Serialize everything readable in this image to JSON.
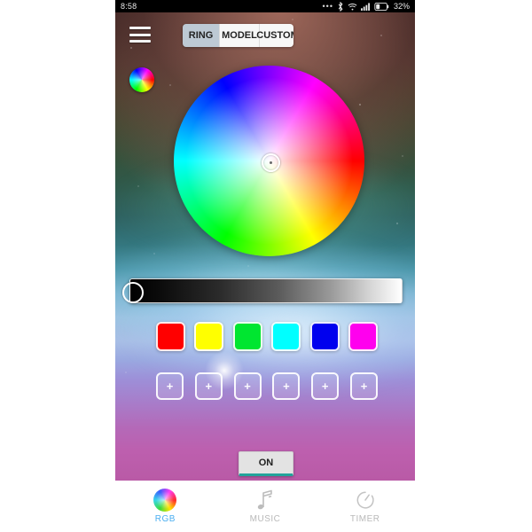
{
  "statusbar": {
    "time": "8:58",
    "more_dots": "•••",
    "bluetooth_icon": "bluetooth-icon",
    "wifi_icon": "wifi-icon",
    "signal_icon": "signal-icon",
    "battery_icon": "battery-icon",
    "battery_pct": "32%"
  },
  "topbar": {
    "menu_icon": "hamburger-menu-icon",
    "wheel_icon": "color-wheel-icon",
    "tabs": [
      {
        "label": "RING",
        "selected": true
      },
      {
        "label": "MODEL",
        "selected": false
      },
      {
        "label": "CUSTOM",
        "selected": false
      }
    ]
  },
  "colorwheel": {
    "name": "hsv-color-wheel",
    "knob_position": "center",
    "knob_color": "#ffffff"
  },
  "brightness": {
    "name": "brightness-slider",
    "value": "0",
    "min_color": "#000000",
    "max_color": "#ffffff"
  },
  "swatches": [
    {
      "name": "swatch-red",
      "color": "#ff0000"
    },
    {
      "name": "swatch-yellow",
      "color": "#ffff00"
    },
    {
      "name": "swatch-green",
      "color": "#00e630"
    },
    {
      "name": "swatch-cyan",
      "color": "#00ffff"
    },
    {
      "name": "swatch-blue",
      "color": "#0000ee"
    },
    {
      "name": "swatch-magenta",
      "color": "#ff00ee"
    }
  ],
  "custom_slots": [
    {
      "label": "+"
    },
    {
      "label": "+"
    },
    {
      "label": "+"
    },
    {
      "label": "+"
    },
    {
      "label": "+"
    },
    {
      "label": "+"
    }
  ],
  "power": {
    "label": "ON",
    "accent_color": "#23a39a"
  },
  "bottomnav": {
    "active_color": "#4aaef0",
    "inactive_color": "#b9b9b9",
    "items": [
      {
        "label": "RGB",
        "icon": "color-wheel-icon",
        "active": true
      },
      {
        "label": "MUSIC",
        "icon": "music-note-icon",
        "active": false
      },
      {
        "label": "TIMER",
        "icon": "timer-icon",
        "active": false
      }
    ]
  }
}
